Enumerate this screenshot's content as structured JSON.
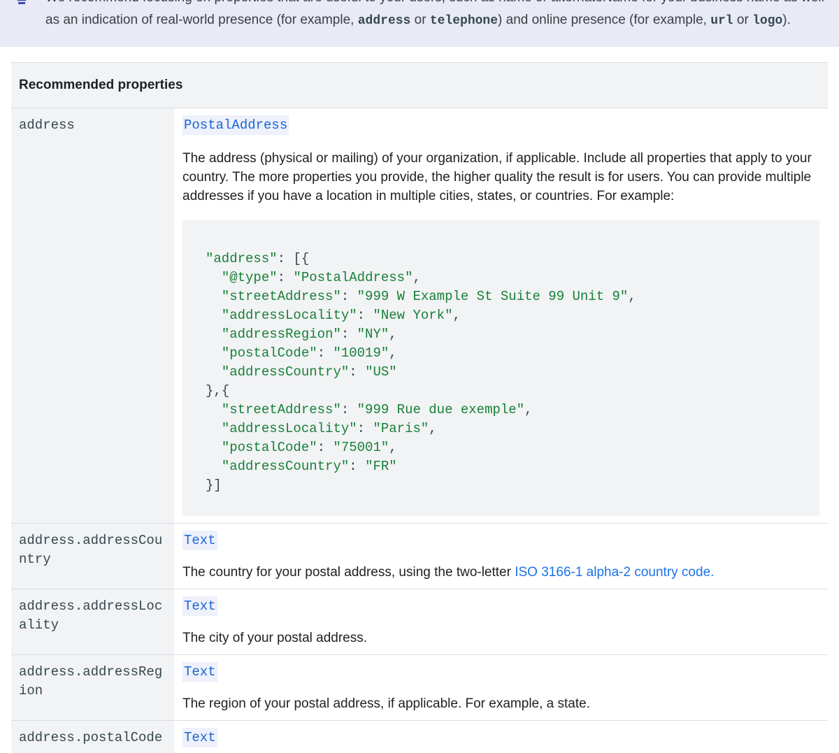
{
  "note": {
    "line1_text": "We recommend focusing on properties that are useful to your users, such as name or alternateName for your business name as well",
    "line2_parts": [
      {
        "t": "as an indication of real-world presence (for example, "
      },
      {
        "c": "address"
      },
      {
        "t": " or "
      },
      {
        "c": "telephone"
      },
      {
        "t": ") and online presence (for example, "
      },
      {
        "c": "url"
      },
      {
        "t": " or "
      },
      {
        "c": "logo"
      },
      {
        "t": ")."
      }
    ]
  },
  "table": {
    "header": "Recommended properties",
    "rows": [
      {
        "name": "address",
        "type": "PostalAddress",
        "description": "The address (physical or mailing) of your organization, if applicable. Include all properties that apply to your country. The more properties you provide, the higher quality the result is for users. You can provide multiple addresses if you have a location in multiple cities, states, or countries. For example:",
        "code": [
          "\"address\": [{",
          "  \"@type\": \"PostalAddress\",",
          "  \"streetAddress\": \"999 W Example St Suite 99 Unit 9\",",
          "  \"addressLocality\": \"New York\",",
          "  \"addressRegion\": \"NY\",",
          "  \"postalCode\": \"10019\",",
          "  \"addressCountry\": \"US\"",
          "},{",
          "  \"streetAddress\": \"999 Rue due exemple\",",
          "  \"addressLocality\": \"Paris\",",
          "  \"postalCode\": \"75001\",",
          "  \"addressCountry\": \"FR\"",
          "}]"
        ]
      },
      {
        "name": "address.addressCountry",
        "type": "Text",
        "description": "The country for your postal address, using the two-letter ",
        "link": "ISO 3166-1 alpha-2 country code."
      },
      {
        "name": "address.addressLocality",
        "type": "Text",
        "description": "The city of your postal address."
      },
      {
        "name": "address.addressRegion",
        "type": "Text",
        "description": "The region of your postal address, if applicable. For example, a state."
      },
      {
        "name": "address.postalCode",
        "type": "Text"
      }
    ]
  },
  "colors": {
    "note_bg": "#e8eaf6",
    "name_col_bg": "#f1f3f4",
    "link": "#1a73e8",
    "type": "#1967d2",
    "code_string": "#188038"
  }
}
